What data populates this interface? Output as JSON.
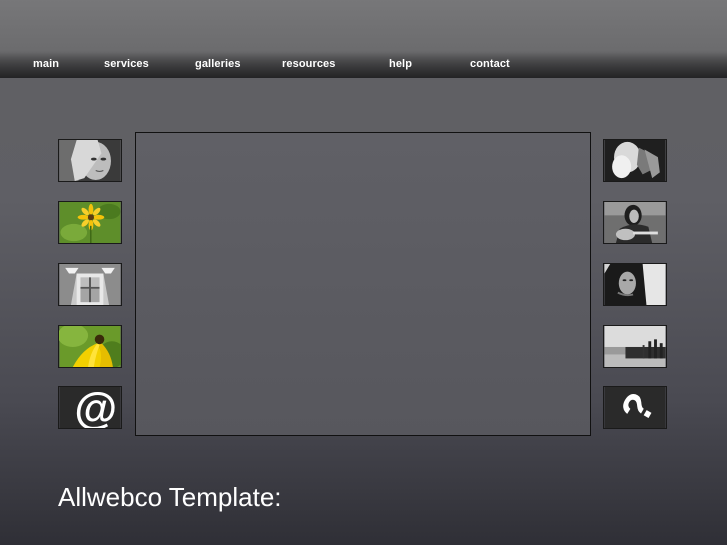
{
  "nav": {
    "items": [
      {
        "label": "main"
      },
      {
        "label": "services"
      },
      {
        "label": "galleries"
      },
      {
        "label": "resources"
      },
      {
        "label": "help"
      },
      {
        "label": "contact"
      }
    ]
  },
  "thumbnails": {
    "left": [
      {
        "icon": "portrait-woman-photo"
      },
      {
        "icon": "yellow-flower-photo"
      },
      {
        "icon": "window-photo"
      },
      {
        "icon": "yellow-flower-closeup-photo"
      },
      {
        "icon": "at-sign-icon"
      }
    ],
    "right": [
      {
        "icon": "hands-photo"
      },
      {
        "icon": "woman-guitar-photo"
      },
      {
        "icon": "woman-portrait-dark-photo"
      },
      {
        "icon": "beach-fence-photo"
      },
      {
        "icon": "question-mark-icon"
      }
    ]
  },
  "content": {
    "title": "Allwebco Template:"
  },
  "colors": {
    "text": "#ffffff",
    "accent_green": "#6a9a2a",
    "accent_yellow": "#f2c400"
  }
}
